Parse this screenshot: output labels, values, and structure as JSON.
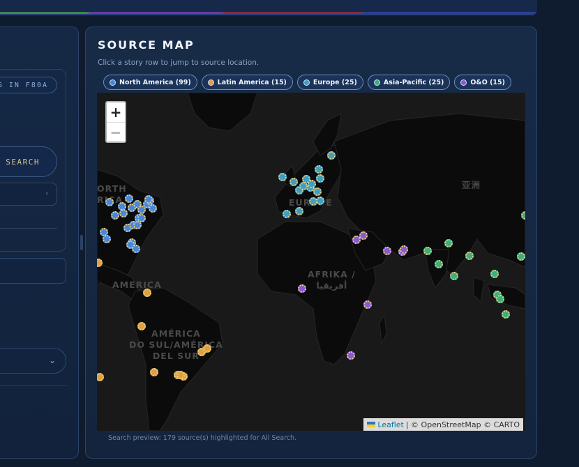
{
  "left_panel": {
    "chip_label": "G IN F80A",
    "search_label": "SEARCH",
    "select_chevron": "›",
    "dropdown_chevron": "⌄"
  },
  "map_panel": {
    "title": "SOURCE MAP",
    "subtitle": "Click a story row to jump to source location.",
    "legend": [
      {
        "label": "North America (99)",
        "color": "#4a86d8"
      },
      {
        "label": "Latin America (15)",
        "color": "#e0a040"
      },
      {
        "label": "Europe (25)",
        "color": "#3f9fc0"
      },
      {
        "label": "Asia-Pacific (25)",
        "color": "#3fae7a"
      },
      {
        "label": "O&O (15)",
        "color": "#8a5ad0"
      }
    ],
    "zoom_in": "+",
    "zoom_out": "−",
    "attribution_link": "Leaflet",
    "attribution_rest": "| © OpenStreetMap © CARTO",
    "map_labels": {
      "north_america": "ORTH\nRICA",
      "america": "AMERICA",
      "south_america": "AMÉRICA\nDO SUL/AMÉRICA\nDEL SUR",
      "europe": "EUROPE",
      "africa": "AFRIKA /\nأفريقيا",
      "asia": "亚洲"
    },
    "footer": "Search preview: 179 source(s) highlighted for All Search."
  },
  "colors": {
    "north_america": "#4a86d8",
    "latin_america": "#e0a040",
    "europe": "#3f9fc0",
    "asia_pacific": "#3fae7a",
    "oando": "#8a5ad0"
  }
}
